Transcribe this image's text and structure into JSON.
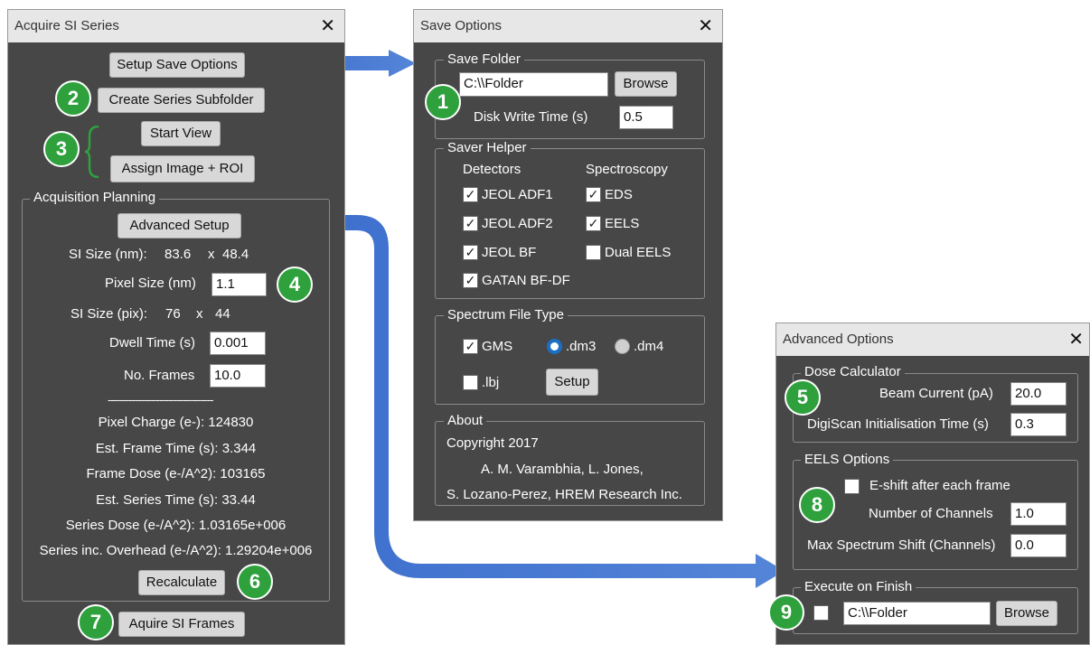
{
  "acquire": {
    "title": "Acquire SI Series",
    "close": "✕",
    "setup_save_options": "Setup Save Options",
    "create_subfolder": "Create Series Subfolder",
    "start_view": "Start View",
    "assign_image_roi": "Assign Image + ROI",
    "group_label": "Acquisition Planning",
    "advanced_setup": "Advanced Setup",
    "si_size_nm_label": "SI Size (nm):",
    "si_size_nm_x": "83.6",
    "si_size_nm_sep": "x",
    "si_size_nm_y": "48.4",
    "pixel_size_label": "Pixel Size (nm)",
    "pixel_size_value": "1.1",
    "si_size_pix_label": "SI Size (pix):",
    "si_size_pix_x": "76",
    "si_size_pix_sep": "x",
    "si_size_pix_y": "44",
    "dwell_label": "Dwell Time (s)",
    "dwell_value": "0.001",
    "frames_label": "No. Frames",
    "frames_value": "10.0",
    "separator": "-----------------------------------",
    "pixel_charge": "Pixel Charge (e-): 124830",
    "frame_time": "Est. Frame Time (s): 3.344",
    "frame_dose": "Frame Dose (e-/A^2): 103165",
    "series_time": "Est. Series Time (s): 33.44",
    "series_dose": "Series Dose (e-/A^2): 1.03165e+006",
    "series_overhead": "Series inc. Overhead (e-/A^2): 1.29204e+006",
    "recalculate": "Recalculate",
    "acquire_frames": "Aquire SI Frames"
  },
  "save": {
    "title": "Save Options",
    "close": "✕",
    "folder_group": "Save Folder",
    "folder_value": "C:\\\\Folder",
    "browse": "Browse",
    "disk_write_label": "Disk Write Time (s)",
    "disk_write_value": "0.5",
    "helper_group": "Saver Helper",
    "detectors_header": "Detectors",
    "spectroscopy_header": "Spectroscopy",
    "detectors": [
      {
        "label": "JEOL ADF1",
        "checked": true
      },
      {
        "label": "JEOL ADF2",
        "checked": true
      },
      {
        "label": "JEOL BF",
        "checked": true
      },
      {
        "label": "GATAN BF-DF",
        "checked": true
      }
    ],
    "spectroscopy": [
      {
        "label": "EDS",
        "checked": true
      },
      {
        "label": "EELS",
        "checked": true
      },
      {
        "label": "Dual EELS",
        "checked": false
      }
    ],
    "filetype_group": "Spectrum File Type",
    "gms_label": "GMS",
    "dm3_label": ".dm3",
    "dm4_label": ".dm4",
    "selected_format": ".dm3",
    "lbj_label": ".lbj",
    "setup": "Setup",
    "about_group": "About",
    "copyright": "Copyright 2017",
    "authors1": "A. M. Varambhia, L. Jones,",
    "authors2": "S. Lozano-Perez, HREM Research Inc."
  },
  "advanced": {
    "title": "Advanced Options",
    "close": "✕",
    "dose_group": "Dose Calculator",
    "beam_current_label": "Beam Current (pA)",
    "beam_current_value": "20.0",
    "digiscan_label": "DigiScan Initialisation Time (s)",
    "digiscan_value": "0.3",
    "eels_group": "EELS Options",
    "eshift_label": "E-shift after each frame",
    "channels_label": "Number of Channels",
    "channels_value": "1.0",
    "max_shift_label": "Max Spectrum Shift (Channels)",
    "max_shift_value": "0.0",
    "execute_group": "Execute on Finish",
    "execute_folder": "C:\\\\Folder",
    "browse": "Browse"
  },
  "badges": [
    "1",
    "2",
    "3",
    "4",
    "5",
    "6",
    "7",
    "8",
    "9"
  ],
  "colors": {
    "window_bg": "#474747",
    "badge": "#2ea13d",
    "arrow": "#3a6ccc",
    "radio_selected": "#1c6fc4"
  }
}
